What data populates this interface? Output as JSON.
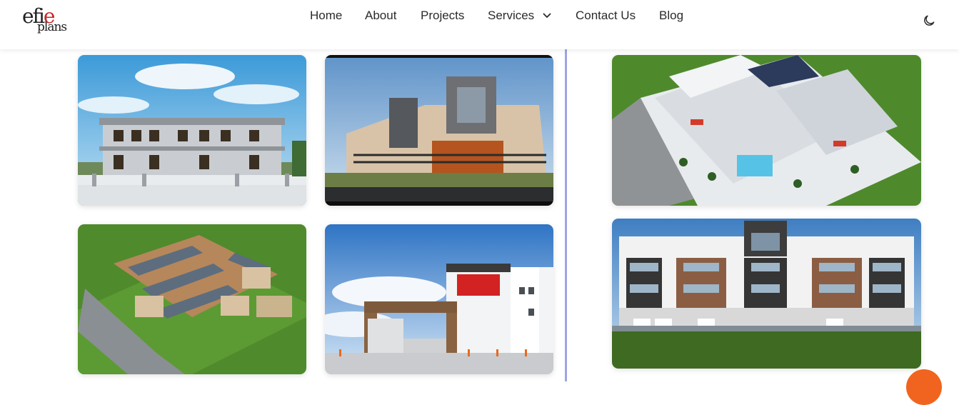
{
  "brand": {
    "logo_line1_a": "efi",
    "logo_line1_b": "e",
    "logo_line2": "plans"
  },
  "nav": {
    "items": [
      {
        "label": "Home"
      },
      {
        "label": "About"
      },
      {
        "label": "Projects"
      },
      {
        "label": "Services",
        "has_dropdown": true
      },
      {
        "label": "Contact Us"
      },
      {
        "label": "Blog"
      }
    ]
  },
  "icons": {
    "theme_toggle": "moon-icon",
    "services_dropdown": "chevron-down-icon"
  },
  "gallery": {
    "left": [
      {
        "name": "white-villa-rendering"
      },
      {
        "name": "modern-duplex-rendering"
      },
      {
        "name": "housing-estate-aerial-rendering"
      },
      {
        "name": "gated-townhouses-rendering"
      }
    ],
    "right": [
      {
        "name": "apartment-block-aerial-rendering"
      },
      {
        "name": "apartment-block-front-rendering"
      }
    ]
  },
  "colors": {
    "accent": "#f0641f",
    "divider": "#9ea4e6",
    "logo_red": "#c62828"
  }
}
